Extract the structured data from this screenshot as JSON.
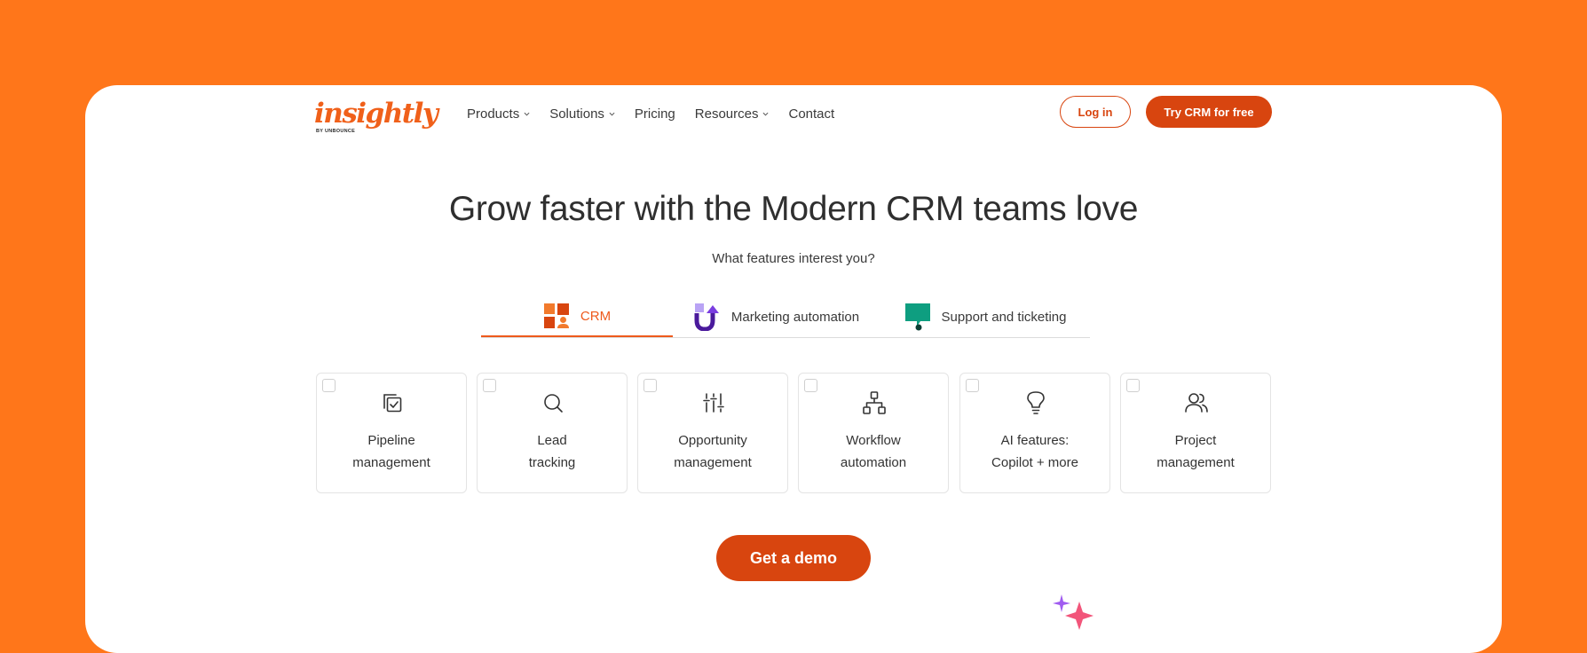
{
  "brand": {
    "logo_text": "insightly",
    "logo_tag": "BY UNBOUNCE",
    "accent": "#D8450F",
    "background": "#FF761A"
  },
  "nav": {
    "items": [
      {
        "label": "Products",
        "has_dropdown": true
      },
      {
        "label": "Solutions",
        "has_dropdown": true
      },
      {
        "label": "Pricing",
        "has_dropdown": false
      },
      {
        "label": "Resources",
        "has_dropdown": true
      },
      {
        "label": "Contact",
        "has_dropdown": false
      }
    ],
    "login_label": "Log in",
    "try_label": "Try CRM for free"
  },
  "hero": {
    "title": "Grow faster with the Modern CRM teams love",
    "subtitle": "What features interest you?"
  },
  "tabs": [
    {
      "label": "CRM",
      "icon": "crm-blocks-icon",
      "active": true
    },
    {
      "label": "Marketing automation",
      "icon": "marketing-arrow-icon",
      "active": false
    },
    {
      "label": "Support and ticketing",
      "icon": "support-chat-icon",
      "active": false
    }
  ],
  "features": [
    {
      "line1": "Pipeline",
      "line2": "management",
      "icon": "pipeline-icon",
      "checked": false
    },
    {
      "line1": "Lead",
      "line2": "tracking",
      "icon": "search-icon",
      "checked": false
    },
    {
      "line1": "Opportunity",
      "line2": "management",
      "icon": "sliders-icon",
      "checked": false
    },
    {
      "line1": "Workflow",
      "line2": "automation",
      "icon": "workflow-icon",
      "checked": false
    },
    {
      "line1": "AI features:",
      "line2": "Copilot + more",
      "icon": "lightbulb-icon",
      "checked": false
    },
    {
      "line1": "Project",
      "line2": "management",
      "icon": "users-icon",
      "checked": false
    }
  ],
  "cta": {
    "demo_label": "Get a demo"
  }
}
